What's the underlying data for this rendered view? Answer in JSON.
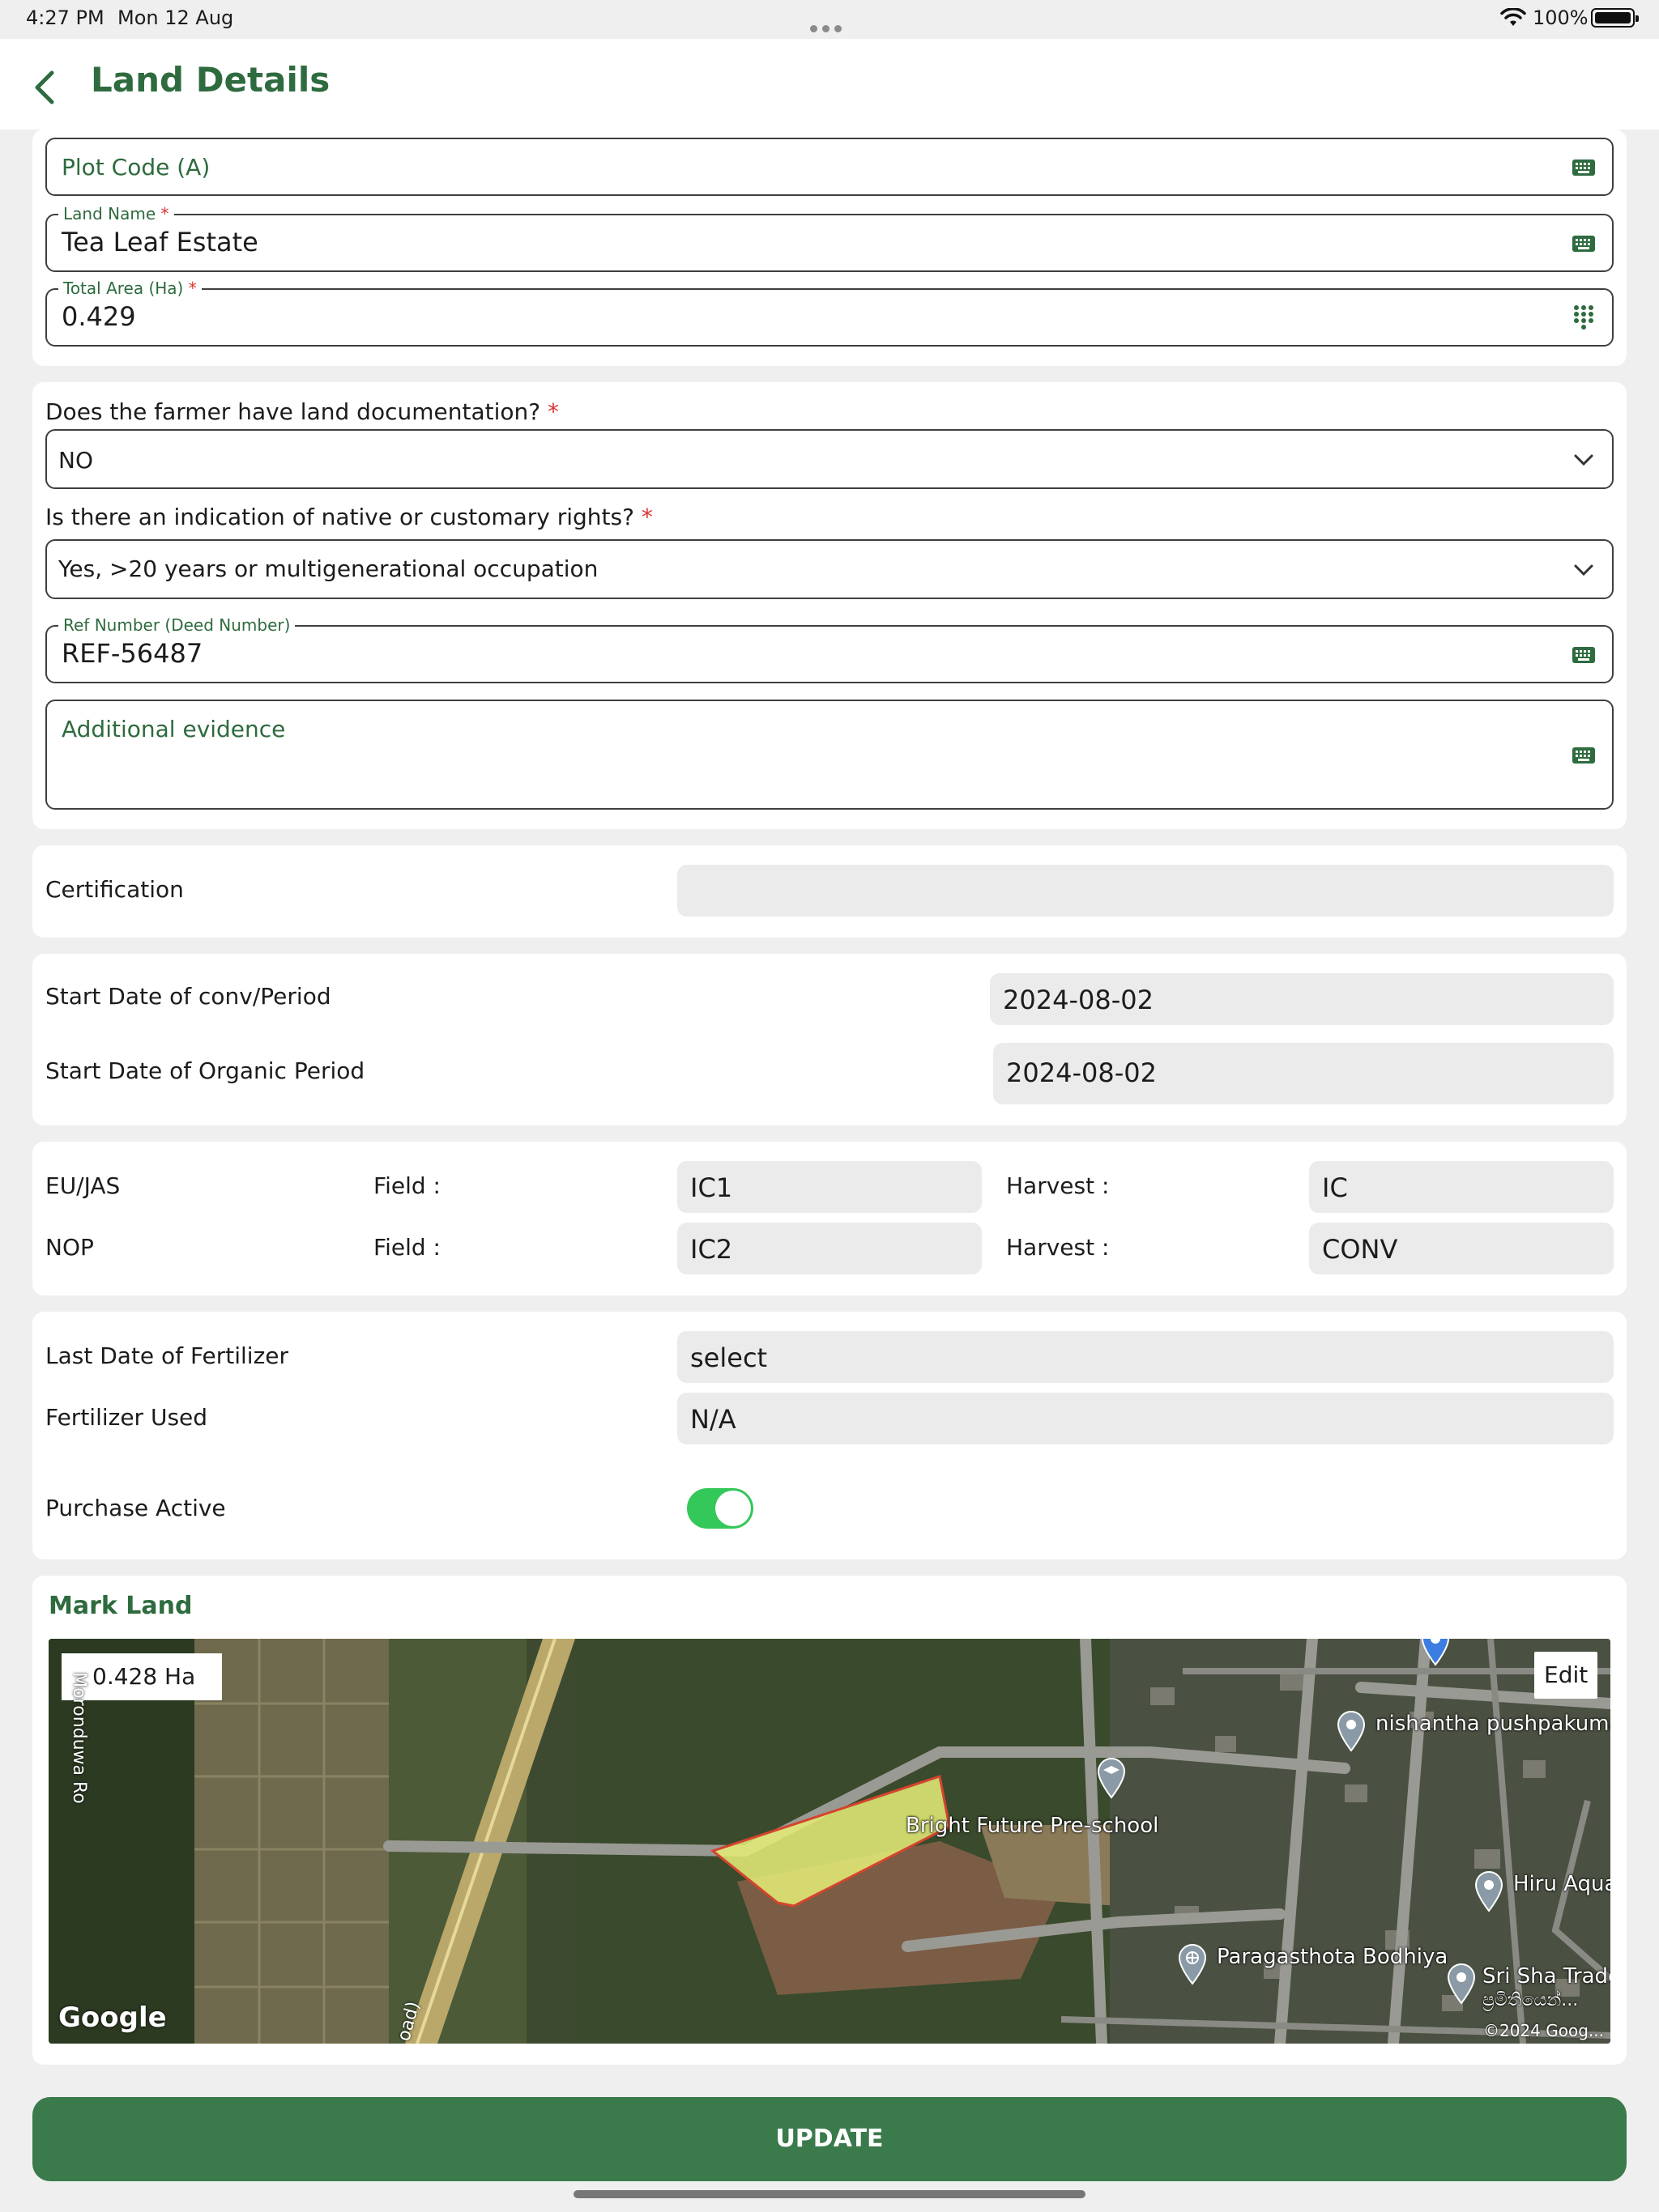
{
  "status_bar": {
    "time": "4:27 PM",
    "date": "Mon 12 Aug",
    "battery": "100%"
  },
  "header": {
    "title": "Land Details"
  },
  "fields": {
    "plot_code": {
      "placeholder": "Plot Code (A)"
    },
    "land_name": {
      "label": "Land Name",
      "required": "*",
      "value": "Tea Leaf Estate"
    },
    "total_area": {
      "label": "Total Area (Ha)",
      "required": "*",
      "value": "0.429"
    }
  },
  "documentation": {
    "question": "Does the farmer have land documentation?",
    "required": "*",
    "value": "NO"
  },
  "customary_rights": {
    "question": "Is there an indication of native or customary rights?",
    "required": "*",
    "value": "Yes, >20 years or multigenerational occupation"
  },
  "ref_number": {
    "label": "Ref Number (Deed Number)",
    "value": "REF-56487"
  },
  "additional_evidence": {
    "placeholder": "Additional evidence"
  },
  "certification": {
    "label": "Certification",
    "value": ""
  },
  "periods": {
    "conv_label": "Start Date of conv/Period",
    "conv_value": "2024-08-02",
    "organic_label": "Start Date of Organic Period",
    "organic_value": "2024-08-02"
  },
  "standards": [
    {
      "name": "EU/JAS",
      "field_label": "Field :",
      "field_value": "IC1",
      "harvest_label": "Harvest :",
      "harvest_value": "IC"
    },
    {
      "name": "NOP",
      "field_label": "Field :",
      "field_value": "IC2",
      "harvest_label": "Harvest :",
      "harvest_value": "CONV"
    }
  ],
  "fertilizer": {
    "last_date_label": "Last Date of Fertilizer",
    "last_date_value": "select",
    "used_label": "Fertilizer Used",
    "used_value": "N/A",
    "purchase_label": "Purchase Active",
    "purchase_active": true
  },
  "map": {
    "title": "Mark Land",
    "area": "0.428 Ha",
    "edit_label": "Edit",
    "places": {
      "preschool": "Bright Future Pre-school",
      "nishantha": "nishantha pushpakumar",
      "hiru": "Hiru Aqua",
      "paragasthota": "Paragasthota Bodhiya",
      "srisha": "Sri Sha Trade",
      "srisha_sub": "ප්‍රමිතියෙන්...",
      "road_left": "Moronduwa Ro",
      "road_bottom": "oad)"
    },
    "logo": "Google",
    "copyright": "©2024 Goog..."
  },
  "update_button": "UPDATE"
}
